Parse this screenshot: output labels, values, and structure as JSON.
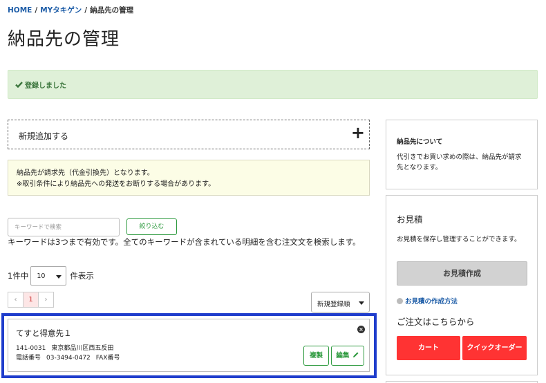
{
  "breadcrumb": {
    "home": "HOME",
    "sep1": "/",
    "mytakigen": "MYタキゲン",
    "sep2": "/",
    "current": "納品先の管理"
  },
  "page_title": "納品先の管理",
  "alert": {
    "text": "登録しました"
  },
  "add_panel": {
    "label": "新規追加する",
    "plus": "+"
  },
  "notice": {
    "line1": "納品先が請求先（代金引換先）となります。",
    "line2": "※取引条件により納品先への発送をお断りする場合があります。"
  },
  "search": {
    "placeholder": "キーワードで検索",
    "button": "絞り込む",
    "help": "キーワードは3つまで有効です。全てのキーワードが含まれている明細を含む注文文を検索します。"
  },
  "listing": {
    "count_text": "1件中",
    "per_page": "10",
    "suffix": "件表示"
  },
  "pager": {
    "prev": "‹",
    "page": "1",
    "next": "›"
  },
  "sort": {
    "selected": "新規登録順"
  },
  "delivery_card": {
    "name": "てすと得意先１",
    "postal": "141-0031",
    "address": "東京都品川区西五反田",
    "phone_label": "電話番号",
    "phone": "03-3494-0472",
    "fax_label": "FAX番号",
    "copy_button": "複製",
    "edit_button": "編集"
  },
  "sidebar": {
    "about": {
      "title": "納品先について",
      "text": "代引きでお買い求めの際は、納品先が請求先となります。"
    },
    "quote": {
      "title": "お見積",
      "text": "お見積を保存し管理することができます。",
      "button": "お見積作成",
      "howto": "お見積の作成方法",
      "order_title": "ご注文はこちらから",
      "cart_button": "カート",
      "quick_button": "クイックオーダー"
    }
  },
  "colors": {
    "link": "#1f5ea8",
    "success_bg": "#dff0d8",
    "success_text": "#3c763d",
    "green_button": "#2e9a3f",
    "red_button": "#ff3333",
    "highlight_border": "#1f3dcc",
    "notice_bg": "#fcfde6"
  }
}
